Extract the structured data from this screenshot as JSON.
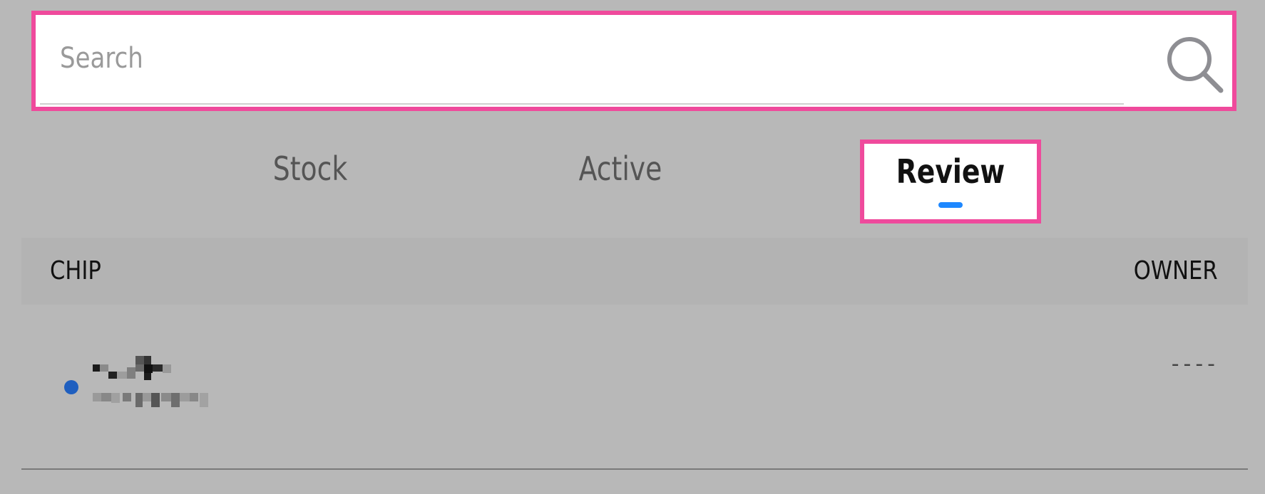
{
  "search": {
    "placeholder": "Search",
    "value": ""
  },
  "tabs": [
    {
      "label": "Stock",
      "selected": false
    },
    {
      "label": "Active",
      "selected": false
    },
    {
      "label": "Review",
      "selected": true
    }
  ],
  "table": {
    "columns": {
      "chip": "CHIP",
      "owner": "OWNER"
    },
    "rows": [
      {
        "status": "active-dot",
        "chip_name": "",
        "chip_detail": "",
        "owner": "----"
      }
    ]
  },
  "colors": {
    "highlight": "#ef4a9c",
    "accent": "#1e88ff",
    "status_dot": "#1f5fbf",
    "background": "#b8b8b8"
  },
  "icons": {
    "search": "search-icon"
  }
}
